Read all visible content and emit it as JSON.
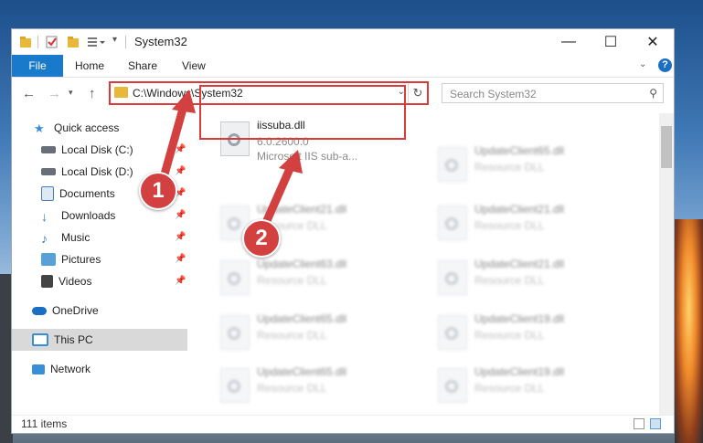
{
  "window": {
    "title": "System32",
    "controls": {
      "minimize": "—",
      "maximize": "☐",
      "close": "✕"
    }
  },
  "ribbon": {
    "file": "File",
    "tabs": [
      "Home",
      "Share",
      "View"
    ],
    "help": "?"
  },
  "address": {
    "path": "C:\\Windows\\System32",
    "search_placeholder": "Search System32"
  },
  "sidebar": {
    "items": [
      {
        "label": "Quick access",
        "icon": "star-icon",
        "color": "#3a8ed8"
      },
      {
        "label": "Local Disk (C:)",
        "icon": "drive-icon",
        "color": "#6a6f77"
      },
      {
        "label": "Local Disk (D:)",
        "icon": "drive-icon",
        "color": "#6a6f77"
      },
      {
        "label": "Documents",
        "icon": "documents-icon",
        "color": "#4b7fb8"
      },
      {
        "label": "Downloads",
        "icon": "download-icon",
        "color": "#2f7fd2"
      },
      {
        "label": "Music",
        "icon": "music-icon",
        "color": "#3a78c9"
      },
      {
        "label": "Pictures",
        "icon": "pictures-icon",
        "color": "#58a0d8"
      },
      {
        "label": "Videos",
        "icon": "videos-icon",
        "color": "#444"
      },
      {
        "label": "OneDrive",
        "icon": "cloud-icon",
        "color": "#1a6fc4"
      },
      {
        "label": "This PC",
        "icon": "computer-icon",
        "color": "#3a8ed8"
      },
      {
        "label": "Network",
        "icon": "network-icon",
        "color": "#3a8ed8"
      }
    ]
  },
  "files": {
    "selected": {
      "name": "iissuba.dll",
      "version": "6.0.2600.0",
      "description": "Microsoft IIS sub-a..."
    },
    "col1": [
      {
        "name": "UpdateClient21.dll",
        "type": "Resource DLL"
      },
      {
        "name": "UpdateClient63.dll",
        "type": "Resource DLL"
      },
      {
        "name": "UpdateClient65.dll",
        "type": "Resource DLL"
      },
      {
        "name": "UpdateClient65.dll",
        "type": "Resource DLL"
      }
    ],
    "col2": [
      {
        "name": "UpdateClient65.dll",
        "type": "Resource DLL"
      },
      {
        "name": "UpdateClient21.dll",
        "type": "Resource DLL"
      },
      {
        "name": "UpdateClient21.dll",
        "type": "Resource DLL"
      },
      {
        "name": "UpdateClient19.dll",
        "type": "Resource DLL"
      },
      {
        "name": "UpdateClient19.dll",
        "type": "Resource DLL"
      }
    ]
  },
  "status": {
    "count": "111 items"
  },
  "annotations": {
    "step1": "1",
    "step2": "2"
  },
  "colors": {
    "accent": "#1979ca",
    "highlight": "#d93a3a"
  }
}
